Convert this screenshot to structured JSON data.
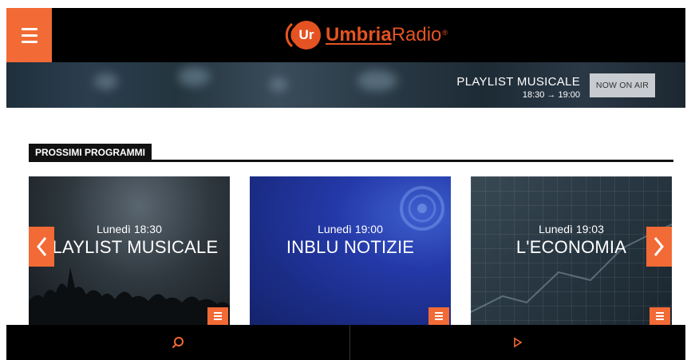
{
  "header": {
    "logo_badge": "Ur",
    "logo_word_1": "Umbria",
    "logo_word_2": "Radio",
    "logo_reg": "®",
    "menu_icon": "hamburger-icon"
  },
  "now_on_air": {
    "title": "PLAYLIST MUSICALE",
    "time": "18:30 → 19:00",
    "button_label": "NOW ON AIR"
  },
  "section": {
    "title": "PROSSIMI PROGRAMMI"
  },
  "programs": [
    {
      "time": "Lunedì 18:30",
      "title": "PLAYLIST MUSICALE"
    },
    {
      "time": "Lunedì 19:00",
      "title": "INBLU NOTIZIE"
    },
    {
      "time": "Lunedì 19:03",
      "title": "L'ECONOMIA"
    }
  ],
  "nav": {
    "prev_icon": "chevron-left-icon",
    "next_icon": "chevron-right-icon",
    "search_icon": "search-icon",
    "play_icon": "play-icon"
  },
  "colors": {
    "accent": "#f26a35",
    "logo": "#e55322",
    "header_bg": "#000000"
  }
}
